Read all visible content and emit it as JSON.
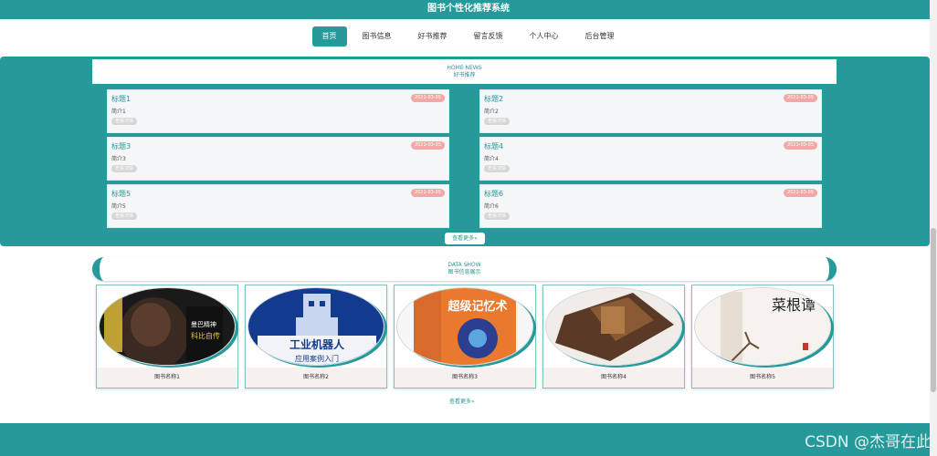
{
  "header": {
    "title": "图书个性化推荐系统"
  },
  "nav": {
    "items": [
      {
        "label": "首页",
        "active": true
      },
      {
        "label": "图书信息"
      },
      {
        "label": "好书推荐"
      },
      {
        "label": "留言反馈"
      },
      {
        "label": "个人中心"
      },
      {
        "label": "后台管理"
      }
    ]
  },
  "news_section": {
    "en": "HOME NEWS",
    "zh": "好书推荐",
    "more": "查看更多»",
    "cards": [
      {
        "title": "标题1",
        "date": "2021-03-05",
        "desc": "简介1",
        "detail": "查看详情"
      },
      {
        "title": "标题2",
        "date": "2021-03-05",
        "desc": "简介2",
        "detail": "查看详情"
      },
      {
        "title": "标题3",
        "date": "2021-03-05",
        "desc": "简介3",
        "detail": "查看详情"
      },
      {
        "title": "标题4",
        "date": "2021-03-05",
        "desc": "简介4",
        "detail": "查看详情"
      },
      {
        "title": "标题5",
        "date": "2021-03-05",
        "desc": "简介5",
        "detail": "查看详情"
      },
      {
        "title": "标题6",
        "date": "2021-03-05",
        "desc": "简介6",
        "detail": "查看详情"
      }
    ]
  },
  "data_section": {
    "en": "DATA SHOW",
    "zh": "图书信息展示",
    "books": [
      {
        "name": "图书名称1"
      },
      {
        "name": "图书名称2"
      },
      {
        "name": "图书名称3"
      },
      {
        "name": "图书名称4"
      },
      {
        "name": "图书名称5"
      }
    ],
    "more": "查看更多»"
  },
  "cover_text": {
    "book1_line1": "曼巴精神",
    "book1_line2": "科比自传",
    "book2_line1": "工业机器人",
    "book2_line2": "应用案例入门",
    "book3": "超级记忆术",
    "book5": "菜根谭"
  },
  "watermark": "CSDN @杰哥在此",
  "colors": {
    "primary": "#26999a",
    "date_badge": "#f4a7a7"
  }
}
